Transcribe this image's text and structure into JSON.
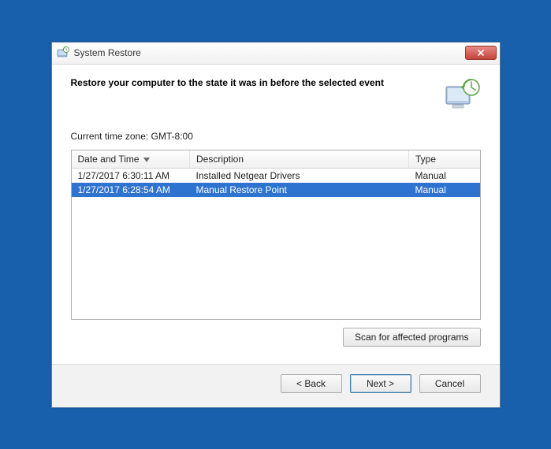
{
  "window": {
    "title": "System Restore"
  },
  "header": {
    "heading": "Restore your computer to the state it was in before the selected event"
  },
  "timezone_label": "Current time zone: GMT-8:00",
  "columns": {
    "datetime": "Date and Time",
    "description": "Description",
    "type": "Type"
  },
  "rows": [
    {
      "datetime": "1/27/2017 6:30:11 AM",
      "description": "Installed Netgear Drivers",
      "type": "Manual",
      "selected": false
    },
    {
      "datetime": "1/27/2017 6:28:54 AM",
      "description": "Manual Restore Point",
      "type": "Manual",
      "selected": true
    }
  ],
  "buttons": {
    "scan": "Scan for affected programs",
    "back": "< Back",
    "next": "Next >",
    "cancel": "Cancel"
  }
}
